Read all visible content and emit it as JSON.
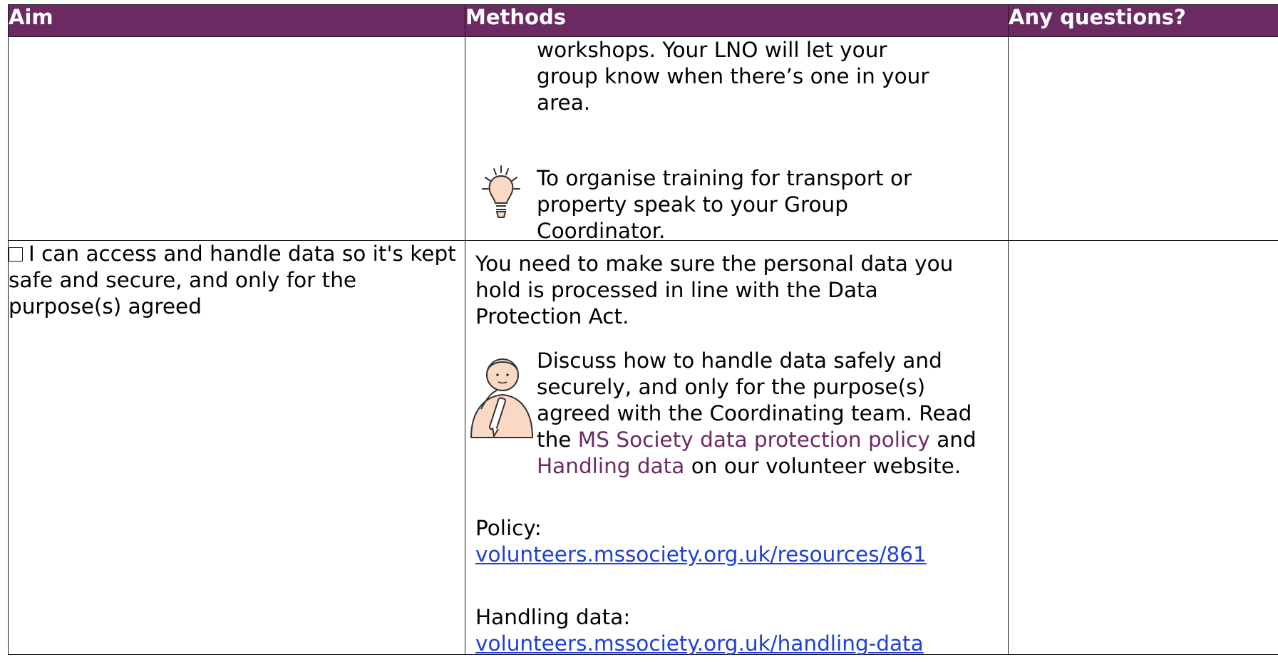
{
  "header": {
    "aim": "Aim",
    "methods": "Methods",
    "questions": "Any questions?"
  },
  "row1": {
    "aim": "",
    "methods_text": "workshops. Your LNO will let your group know when there’s one in your area.",
    "tip_text": "To organise training for transport or property speak to your Group Coordinator.",
    "tip_icon": "lightbulb-icon",
    "questions": ""
  },
  "row2": {
    "checkbox_icon": "checkbox-icon",
    "aim": "I can access and handle data so it's kept safe and secure, and only for the purpose(s) agreed",
    "methods_intro": "You need to make sure the personal data you hold is processed in line with the Data Protection Act.",
    "person_icon": "person-thinking-icon",
    "discuss_text": "Discuss how to handle data safely and securely, and only for the purpose(s) agreed with the Coordinating team. Read the ",
    "policy_link_text": "MS Society data protection policy",
    "and_text": " and ",
    "handling_link_text": "Handling data",
    "website_text": " on our volunteer website.",
    "policy_label": "Policy:",
    "policy_url": "volunteers.mssociety.org.uk/resources/861",
    "handling_label": "Handling data:",
    "handling_url": "volunteers.mssociety.org.uk/handling-data",
    "questions": ""
  },
  "colors": {
    "header_bg": "#6b2a62",
    "header_text": "#ffffff",
    "link": "#1f3fd6",
    "inline_link": "#6b2a62",
    "icon_fill": "#f9d9c4"
  }
}
